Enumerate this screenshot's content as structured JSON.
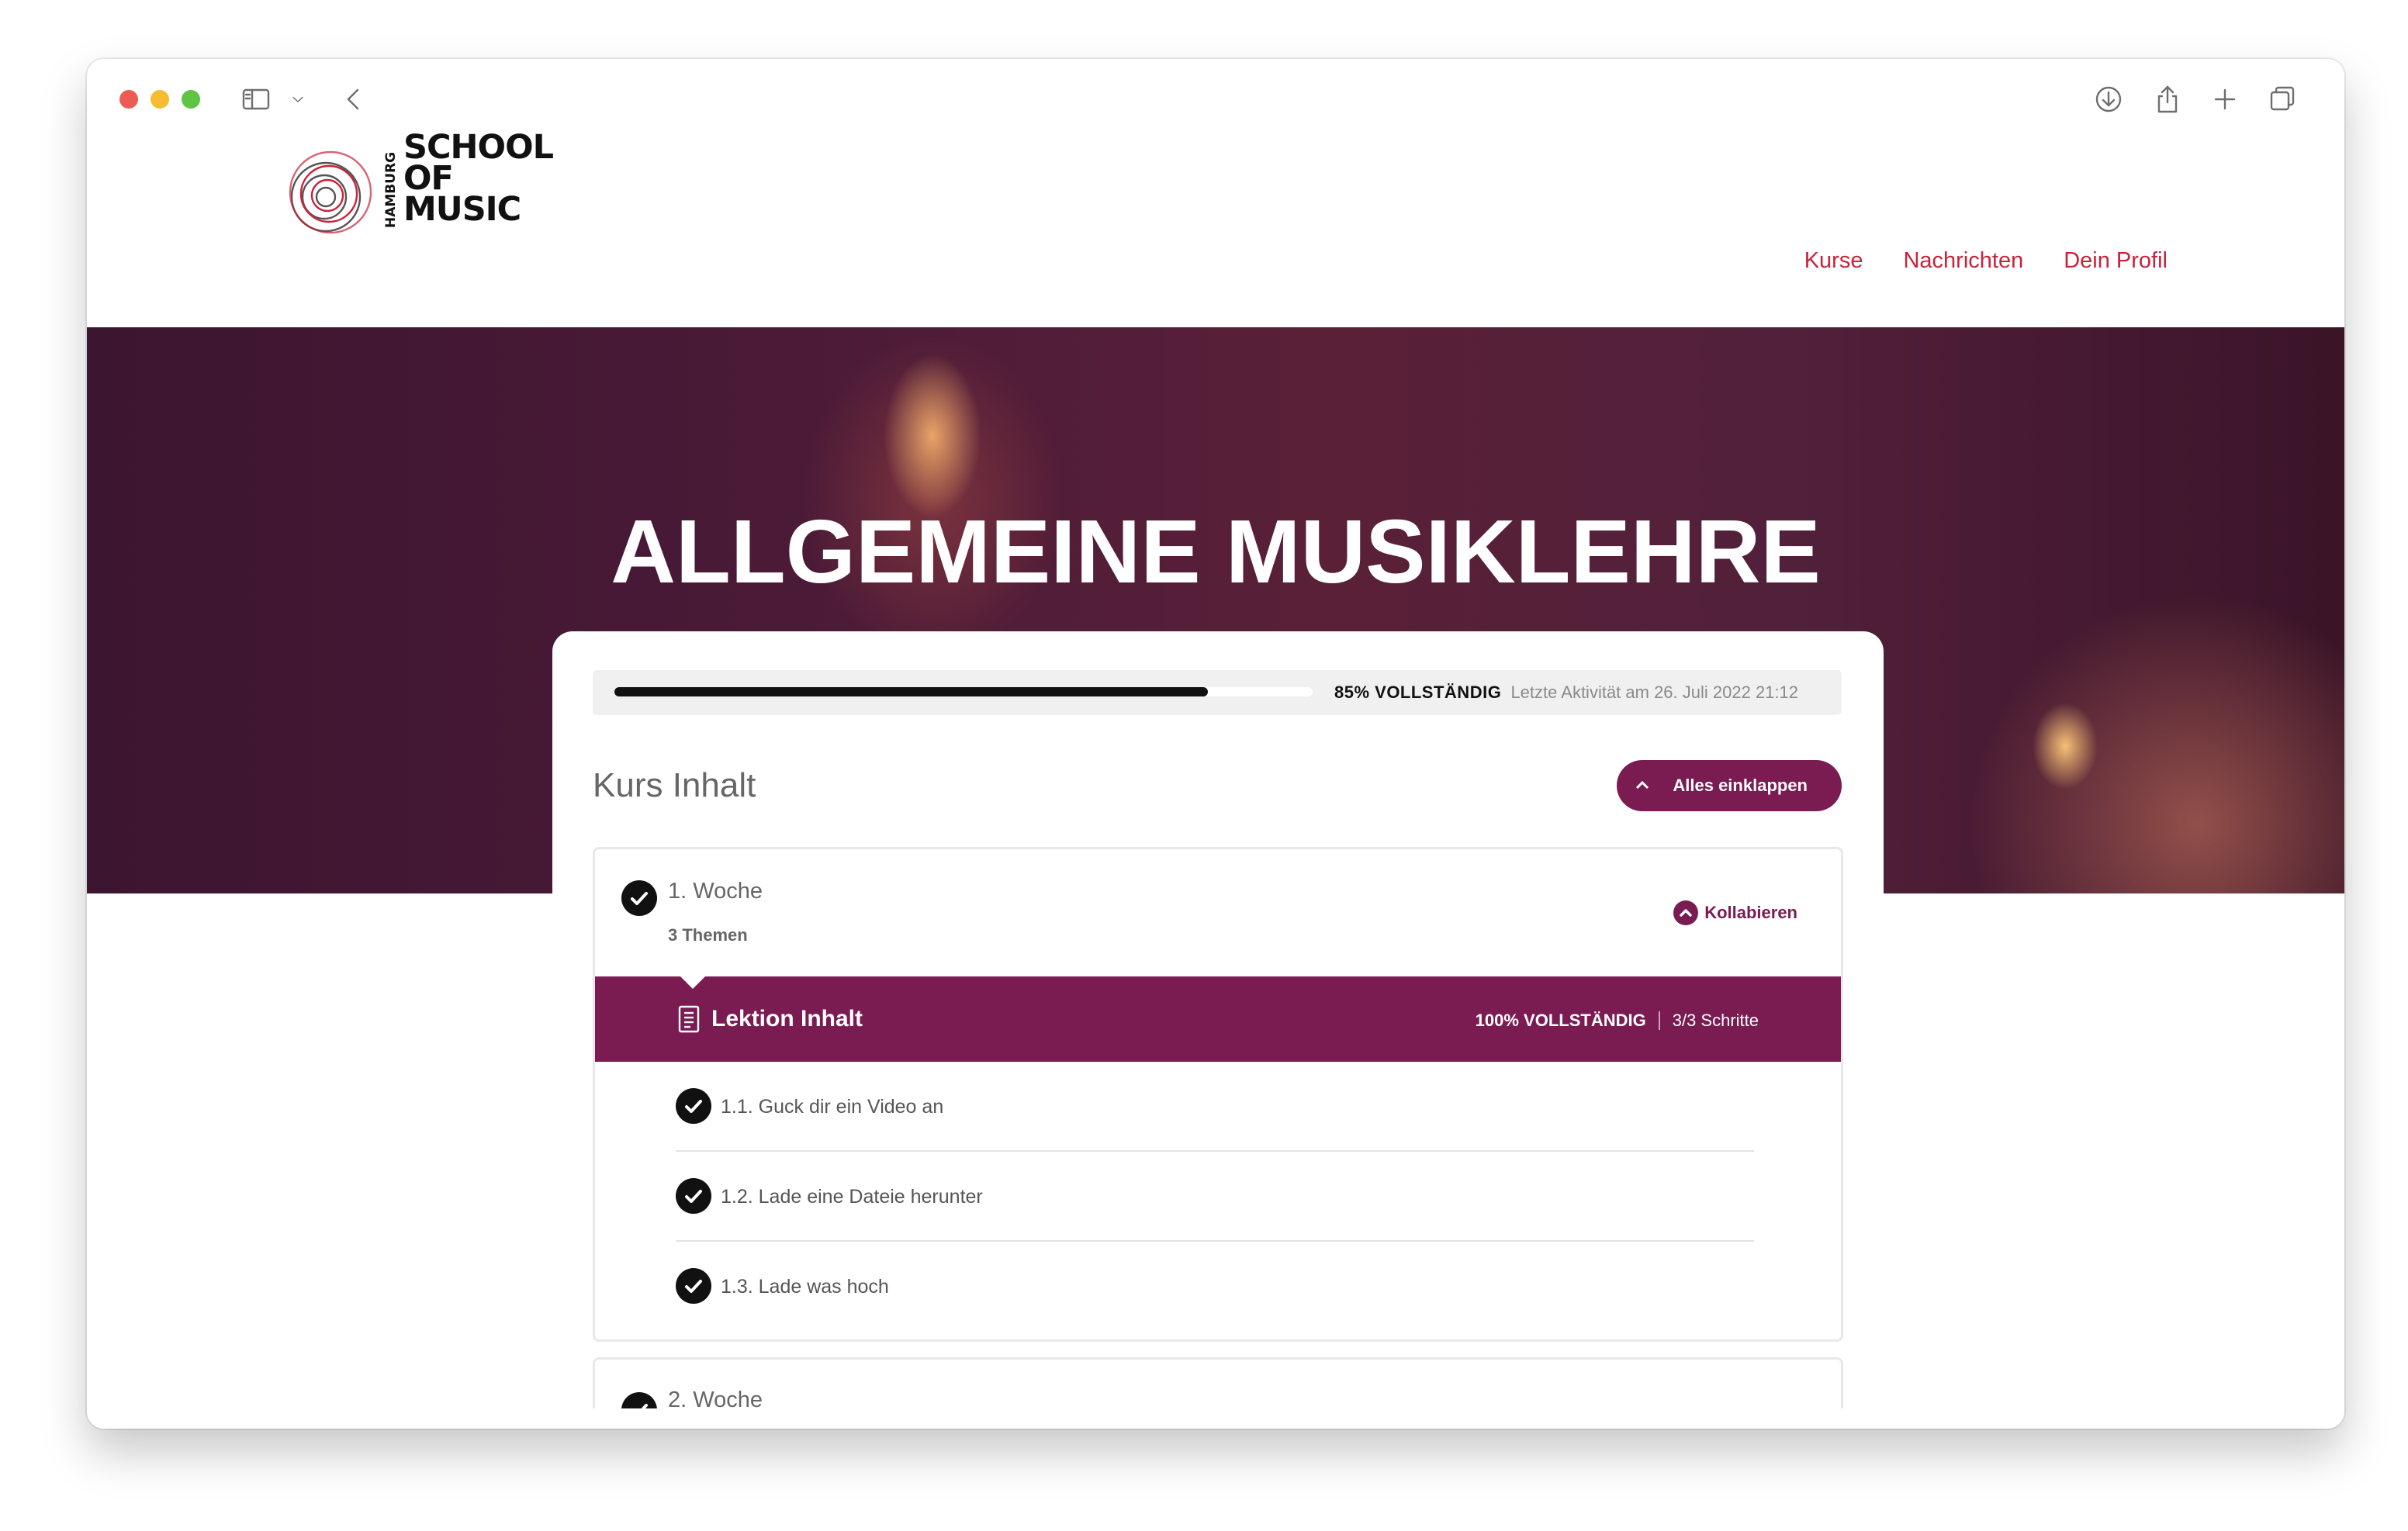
{
  "browser": {
    "icons": [
      "sidebar-icon",
      "chevron-down-icon",
      "back-icon",
      "download-icon",
      "share-icon",
      "plus-icon",
      "tabs-icon"
    ]
  },
  "logo": {
    "vertical_text": "HAMBURG",
    "line1": "SCHOOL",
    "line2": "OF",
    "line3": "MUSIC"
  },
  "nav": {
    "items": [
      "Kurse",
      "Nachrichten",
      "Dein Profil"
    ]
  },
  "hero": {
    "title": "ALLGEMEINE MUSIKLEHRE"
  },
  "progress": {
    "percent": 85,
    "label": "85% VOLLSTÄNDIG",
    "last_activity": "Letzte Aktivität am 26. Juli 2022 21:12"
  },
  "course": {
    "title": "Kurs Inhalt",
    "collapse_all_label": "Alles einklappen",
    "weeks": [
      {
        "title": "1. Woche",
        "subtitle": "3 Themen",
        "collapse_label": "Kollabieren",
        "lesson": {
          "title": "Lektion Inhalt",
          "status": "100% VOLLSTÄNDIG",
          "steps_label": "3/3 Schritte",
          "steps": [
            "1.1. Guck dir ein Video an",
            "1.2. Lade eine Dateie herunter",
            "1.3. Lade was hoch"
          ]
        }
      },
      {
        "title": "2. Woche"
      }
    ]
  },
  "colors": {
    "accent": "#7a1b52",
    "nav_link": "#c8233b",
    "text_dark": "#111111",
    "text_muted": "#666666"
  }
}
